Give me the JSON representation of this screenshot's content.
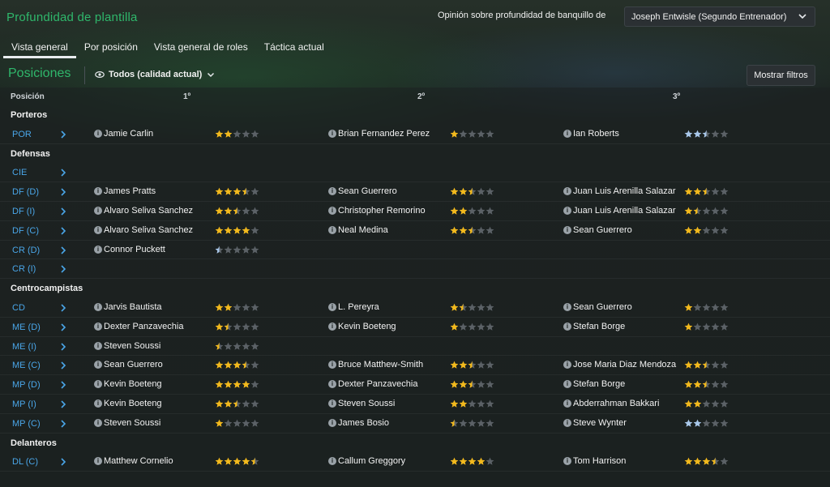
{
  "header": {
    "title": "Profundidad de plantilla",
    "opinion_label": "Opinión sobre profundidad de banquillo de",
    "coach_selected": "Joseph Entwisle (Segundo Entrenador)"
  },
  "tabs": [
    {
      "label": "Vista general",
      "active": true
    },
    {
      "label": "Por posición",
      "active": false
    },
    {
      "label": "Vista general de roles",
      "active": false
    },
    {
      "label": "Táctica actual",
      "active": false
    }
  ],
  "section": {
    "title": "Posiciones",
    "filter_label": "Todos (calidad actual)",
    "filters_button": "Mostrar filtros"
  },
  "columns": {
    "position": "Posición",
    "first": "1º",
    "second": "2º",
    "third": "3º"
  },
  "colors": {
    "accent_green": "#2fb76b",
    "position_blue": "#4aa6e8",
    "star_gold": "#f2b91d",
    "star_blue": "#a9c8ea",
    "star_empty": "#5b6166"
  },
  "groups": [
    {
      "name": "Porteros",
      "rows": [
        {
          "pos": "POR",
          "players": [
            {
              "name": "Jamie Carlin",
              "rating": 2,
              "color": "gold"
            },
            {
              "name": "Brian Fernandez Perez",
              "rating": 1,
              "color": "gold"
            },
            {
              "name": "Ian Roberts",
              "rating": 2.5,
              "color": "blue"
            }
          ]
        }
      ]
    },
    {
      "name": "Defensas",
      "rows": [
        {
          "pos": "CIE",
          "players": []
        },
        {
          "pos": "DF (D)",
          "players": [
            {
              "name": "James Pratts",
              "rating": 3.5,
              "color": "gold"
            },
            {
              "name": "Sean Guerrero",
              "rating": 2.5,
              "color": "gold"
            },
            {
              "name": "Juan Luis Arenilla Salazar",
              "rating": 2.5,
              "color": "gold"
            }
          ]
        },
        {
          "pos": "DF (I)",
          "players": [
            {
              "name": "Alvaro Seliva Sanchez",
              "rating": 2.5,
              "color": "gold"
            },
            {
              "name": "Christopher Remorino",
              "rating": 2,
              "color": "gold"
            },
            {
              "name": "Juan Luis Arenilla Salazar",
              "rating": 1.5,
              "color": "gold"
            }
          ]
        },
        {
          "pos": "DF (C)",
          "players": [
            {
              "name": "Alvaro Seliva Sanchez",
              "rating": 4,
              "color": "gold"
            },
            {
              "name": "Neal Medina",
              "rating": 2.5,
              "color": "gold"
            },
            {
              "name": "Sean Guerrero",
              "rating": 2,
              "color": "gold"
            }
          ]
        },
        {
          "pos": "CR (D)",
          "players": [
            {
              "name": "Connor Puckett",
              "rating": 0.5,
              "color": "blue"
            }
          ]
        },
        {
          "pos": "CR (I)",
          "players": []
        }
      ]
    },
    {
      "name": "Centrocampistas",
      "rows": [
        {
          "pos": "CD",
          "players": [
            {
              "name": "Jarvis Bautista",
              "rating": 2,
              "color": "gold"
            },
            {
              "name": "L. Pereyra",
              "rating": 1.5,
              "color": "gold"
            },
            {
              "name": "Sean Guerrero",
              "rating": 1,
              "color": "gold"
            }
          ]
        },
        {
          "pos": "ME (D)",
          "players": [
            {
              "name": "Dexter Panzavechia",
              "rating": 1.5,
              "color": "gold"
            },
            {
              "name": "Kevin Boeteng",
              "rating": 1,
              "color": "gold"
            },
            {
              "name": "Stefan Borge",
              "rating": 1,
              "color": "gold"
            }
          ]
        },
        {
          "pos": "ME (I)",
          "players": [
            {
              "name": "Steven Soussi",
              "rating": 0.5,
              "color": "gold"
            }
          ]
        },
        {
          "pos": "ME (C)",
          "players": [
            {
              "name": "Sean Guerrero",
              "rating": 3.5,
              "color": "gold"
            },
            {
              "name": "Bruce Matthew-Smith",
              "rating": 2.5,
              "color": "gold"
            },
            {
              "name": "Jose Maria Diaz Mendoza",
              "rating": 2.5,
              "color": "gold"
            }
          ]
        },
        {
          "pos": "MP (D)",
          "players": [
            {
              "name": "Kevin Boeteng",
              "rating": 4,
              "color": "gold"
            },
            {
              "name": "Dexter Panzavechia",
              "rating": 2.5,
              "color": "gold"
            },
            {
              "name": "Stefan Borge",
              "rating": 2.5,
              "color": "gold"
            }
          ]
        },
        {
          "pos": "MP (I)",
          "players": [
            {
              "name": "Kevin Boeteng",
              "rating": 2.5,
              "color": "gold"
            },
            {
              "name": "Steven Soussi",
              "rating": 2,
              "color": "gold"
            },
            {
              "name": "Abderrahman Bakkari",
              "rating": 2,
              "color": "gold"
            }
          ]
        },
        {
          "pos": "MP (C)",
          "players": [
            {
              "name": "Steven Soussi",
              "rating": 1,
              "color": "gold"
            },
            {
              "name": "James Bosio",
              "rating": 0.5,
              "color": "gold"
            },
            {
              "name": "Steve Wynter",
              "rating": 2,
              "color": "blue"
            }
          ]
        }
      ]
    },
    {
      "name": "Delanteros",
      "rows": [
        {
          "pos": "DL (C)",
          "players": [
            {
              "name": "Matthew Cornelio",
              "rating": 4.5,
              "color": "gold"
            },
            {
              "name": "Callum Greggory",
              "rating": 4,
              "color": "gold"
            },
            {
              "name": "Tom Harrison",
              "rating": 3.5,
              "color": "gold"
            }
          ]
        }
      ]
    }
  ]
}
